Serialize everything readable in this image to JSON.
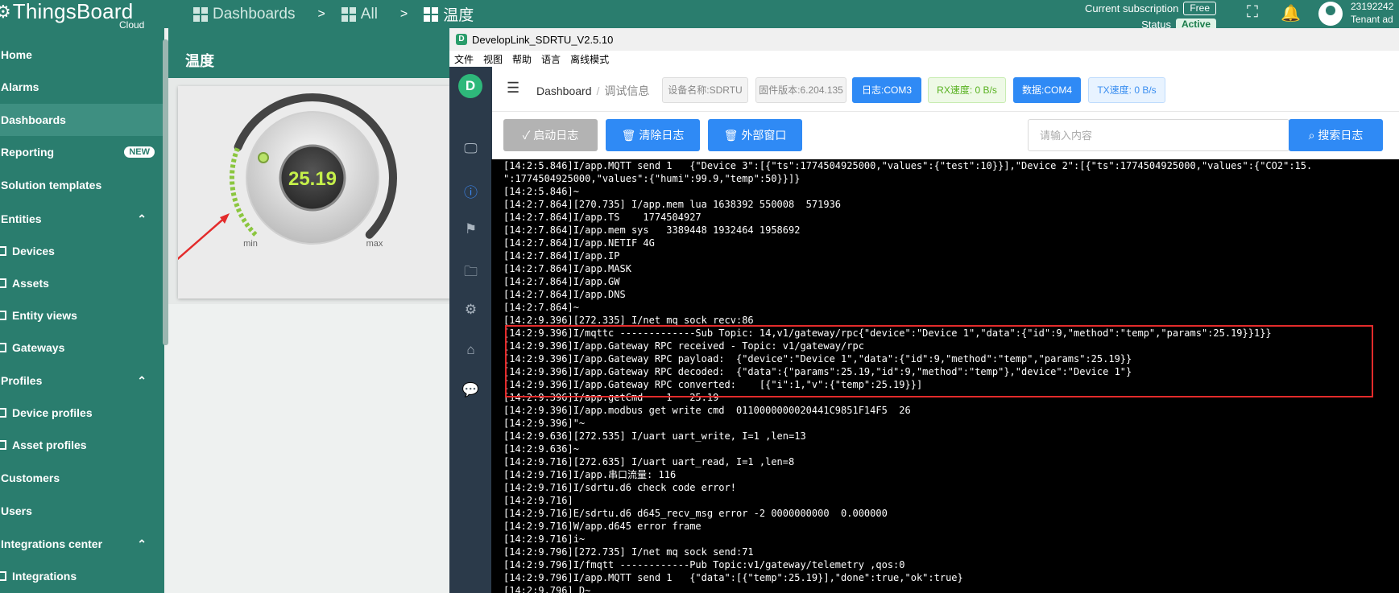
{
  "tb_header": {
    "logo_text": "ThingsBoard",
    "logo_sub": "Cloud",
    "crumbs": [
      "Dashboards",
      "All",
      "温度"
    ],
    "separator": ">",
    "subscription_label": "Current subscription",
    "plan": "Free",
    "status_label": "Status",
    "status": "Active",
    "user_id": "23192242",
    "user_role": "Tenant ad"
  },
  "sidebar": {
    "items": [
      {
        "label": "Home"
      },
      {
        "label": "Alarms"
      },
      {
        "label": "Dashboards",
        "selected": true
      },
      {
        "label": "Reporting",
        "badge": "NEW"
      },
      {
        "label": "Solution templates"
      },
      {
        "label": "Entities",
        "expanded": true
      },
      {
        "label": "Devices",
        "sub": true
      },
      {
        "label": "Assets",
        "sub": true
      },
      {
        "label": "Entity views",
        "sub": true
      },
      {
        "label": "Gateways",
        "sub": true
      },
      {
        "label": "Profiles",
        "expanded": true
      },
      {
        "label": "Device profiles",
        "sub": true
      },
      {
        "label": "Asset profiles",
        "sub": true
      },
      {
        "label": "Customers"
      },
      {
        "label": "Users"
      },
      {
        "label": "Integrations center",
        "expanded": true
      },
      {
        "label": "Integrations",
        "sub": true
      }
    ]
  },
  "dashboard": {
    "title": "温度",
    "gauge": {
      "value": "25.19",
      "min_label": "min",
      "max_label": "max",
      "level": 0.25
    }
  },
  "devlink": {
    "title": "DevelopLink_SDRTU_V2.5.10",
    "menu": [
      "文件",
      "视图",
      "帮助",
      "语言",
      "离线模式"
    ],
    "breadcrumb": {
      "root": "Dashboard",
      "separator": "/",
      "current": "调试信息"
    },
    "chips": {
      "device": "设备名称:SDRTU",
      "firmware": "固件版本:6.204.135",
      "log_port": "日志:COM3",
      "rx": "RX速度: 0 B/s",
      "data_port": "数据:COM4",
      "tx": "TX速度: 0 B/s"
    },
    "toolbar": {
      "start": "启动日志",
      "clear": "清除日志",
      "external": "外部窗口",
      "search_placeholder": "请输入内容",
      "search": "搜索日志"
    },
    "log_lines": [
      "[14:2:5.846]I/app.MQTT send 1   {\"Device 3\":[{\"ts\":1774504925000,\"values\":{\"test\":10}}],\"Device 2\":[{\"ts\":1774504925000,\"values\":{\"CO2\":15.",
      "\":1774504925000,\"values\":{\"humi\":99.9,\"temp\":50}}]}",
      "[14:2:5.846]~",
      "[14:2:7.864][270.735] I/app.mem lua 1638392 550008  571936",
      "[14:2:7.864]I/app.TS    1774504927",
      "[14:2:7.864]I/app.mem sys   3389448 1932464 1958692",
      "[14:2:7.864]I/app.NETIF 4G",
      "[14:2:7.864]I/app.IP",
      "[14:2:7.864]I/app.MASK",
      "[14:2:7.864]I/app.GW",
      "[14:2:7.864]I/app.DNS",
      "[14:2:7.864]~",
      "[14:2:9.396][272.335] I/net mq sock recv:86",
      "[14:2:9.396]I/mqttc -------------Sub Topic: 14,v1/gateway/rpc{\"device\":\"Device 1\",\"data\":{\"id\":9,\"method\":\"temp\",\"params\":25.19}}1}}",
      "[14:2:9.396]I/app.Gateway RPC received - Topic: v1/gateway/rpc",
      "[14:2:9.396]I/app.Gateway RPC payload:  {\"device\":\"Device 1\",\"data\":{\"id\":9,\"method\":\"temp\",\"params\":25.19}}",
      "[14:2:9.396]I/app.Gateway RPC decoded:  {\"data\":{\"params\":25.19,\"id\":9,\"method\":\"temp\"},\"device\":\"Device 1\"}",
      "[14:2:9.396]I/app.Gateway RPC converted:    [{\"i\":1,\"v\":{\"temp\":25.19}}]",
      "[14:2:9.396]I/app.getCmd    1   25.19",
      "[14:2:9.396]I/app.modbus get write cmd  0110000000020441C9851F14F5  26",
      "[14:2:9.396]\"~",
      "[14:2:9.636][272.535] I/uart uart_write, I=1 ,len=13",
      "[14:2:9.636]~",
      "[14:2:9.716][272.635] I/uart uart_read, I=1 ,len=8",
      "[14:2:9.716]I/app.串口流量: 116",
      "[14:2:9.716]I/sdrtu.d6 check code error!",
      "[14:2:9.716]",
      "[14:2:9.716]E/sdrtu.d6 d645_recv_msg error -2 0000000000  0.000000",
      "[14:2:9.716]W/app.d645 error frame",
      "[14:2:9.716]i~",
      "[14:2:9.796][272.735] I/net mq sock send:71",
      "[14:2:9.796]I/fmqtt ------------Pub Topic:v1/gateway/telemetry ,qos:0",
      "[14:2:9.796]I/app.MQTT send 1   {\"data\":[{\"temp\":25.19}],\"done\":true,\"ok\":true}",
      "[14:2:9.796] D~"
    ]
  },
  "colors": {
    "tb_green": "#2a7d6e",
    "accent_blue": "#2f8af5",
    "highlight_red": "#e32b2b",
    "console_bg": "#000000"
  }
}
